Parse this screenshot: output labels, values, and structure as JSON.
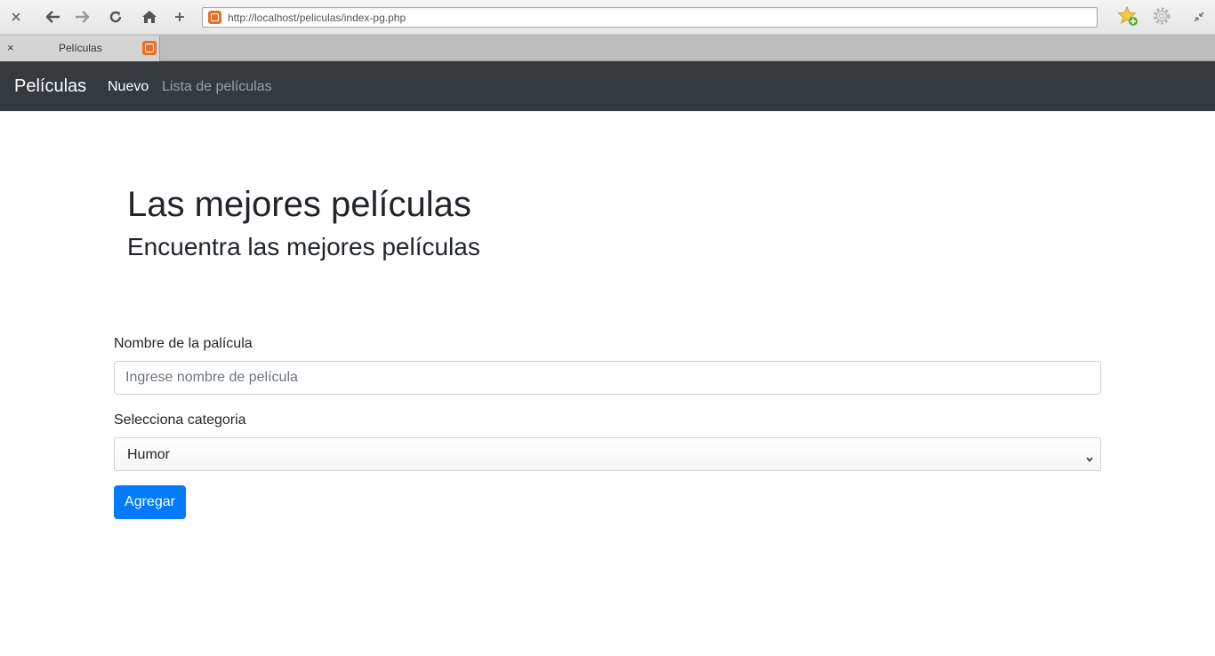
{
  "browser": {
    "url": "http://localhost/peliculas/index-pg.php",
    "tab_title": "Películas",
    "tab_close": "×",
    "icons": [
      "close-icon",
      "back-icon",
      "forward-icon",
      "reload-icon",
      "home-icon",
      "new-tab-icon",
      "site-favicon",
      "bookmark-star-icon",
      "settings-gear-icon",
      "minimize-arrows-icon"
    ]
  },
  "navbar": {
    "brand": "Películas",
    "links": [
      {
        "label": "Nuevo",
        "active": true
      },
      {
        "label": "Lista de películas",
        "active": false
      }
    ],
    "bg_color": "#343a40"
  },
  "hero": {
    "title": "Las mejores películas",
    "subtitle": "Encuentra las mejores películas"
  },
  "form": {
    "name_label": "Nombre de la palícula",
    "name_placeholder": "Ingrese nombre de película",
    "name_value": "",
    "category_label": "Selecciona categoria",
    "category_selected": "Humor",
    "submit_label": "Agregar",
    "accent_color": "#007bff"
  }
}
